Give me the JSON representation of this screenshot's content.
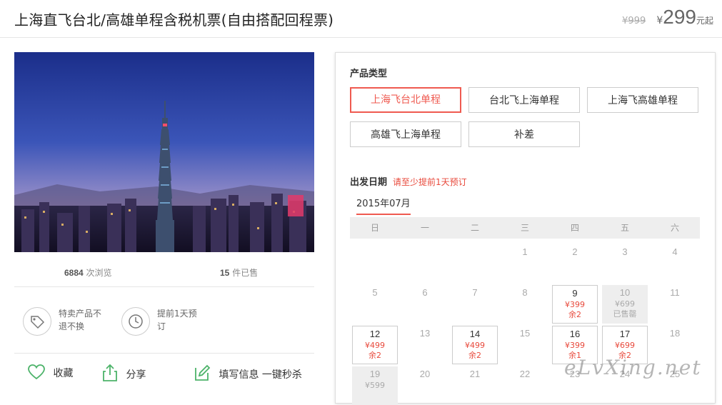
{
  "product": {
    "title": "上海直飞台北/高雄单程含税机票(自由搭配回程票)",
    "old_price": "¥999",
    "currency": "¥",
    "price": "299",
    "price_suffix": "元起"
  },
  "stats": {
    "views_count": "6884",
    "views_label": "次浏览",
    "sold_count": "15",
    "sold_label": "件已售"
  },
  "features": [
    {
      "icon": "tag-icon",
      "text": "特卖产品不退不换"
    },
    {
      "icon": "clock-icon",
      "text": "提前1天预订"
    }
  ],
  "actions": {
    "favorite": "收藏",
    "share": "分享",
    "book": "填写信息 一键秒杀"
  },
  "booking": {
    "type_title": "产品类型",
    "types": [
      "上海飞台北单程",
      "台北飞上海单程",
      "上海飞高雄单程",
      "高雄飞上海单程",
      "补差"
    ],
    "selected_type": "上海飞台北单程",
    "date_title": "出发日期",
    "date_notice": "请至少提前1天预订",
    "month": "2015年07月",
    "weekdays": [
      "日",
      "一",
      "二",
      "三",
      "四",
      "五",
      "六"
    ],
    "days": [
      {
        "day": "1"
      },
      {
        "day": "2"
      },
      {
        "day": "3"
      },
      {
        "day": "4"
      },
      {
        "day": "5"
      },
      {
        "day": "6"
      },
      {
        "day": "7"
      },
      {
        "day": "8"
      },
      {
        "day": "9",
        "price": "¥399",
        "remain": "余2",
        "state": "available"
      },
      {
        "day": "10",
        "price": "¥699",
        "remain": "已售罄",
        "state": "soldout"
      },
      {
        "day": "11"
      },
      {
        "day": "12",
        "price": "¥499",
        "remain": "余2",
        "state": "available"
      },
      {
        "day": "13"
      },
      {
        "day": "14",
        "price": "¥499",
        "remain": "余2",
        "state": "available"
      },
      {
        "day": "15"
      },
      {
        "day": "16",
        "price": "¥399",
        "remain": "余1",
        "state": "available"
      },
      {
        "day": "17",
        "price": "¥699",
        "remain": "余2",
        "state": "available"
      },
      {
        "day": "18"
      },
      {
        "day": "19",
        "price": "¥599",
        "state": "soldout"
      },
      {
        "day": "20"
      },
      {
        "day": "21"
      },
      {
        "day": "22"
      },
      {
        "day": "23"
      },
      {
        "day": "24"
      },
      {
        "day": "25"
      }
    ]
  },
  "watermark": "eLvXing.net",
  "colors": {
    "accent": "#ef5a50",
    "price_red": "#e84a3c",
    "panel_border": "#dddddd"
  }
}
